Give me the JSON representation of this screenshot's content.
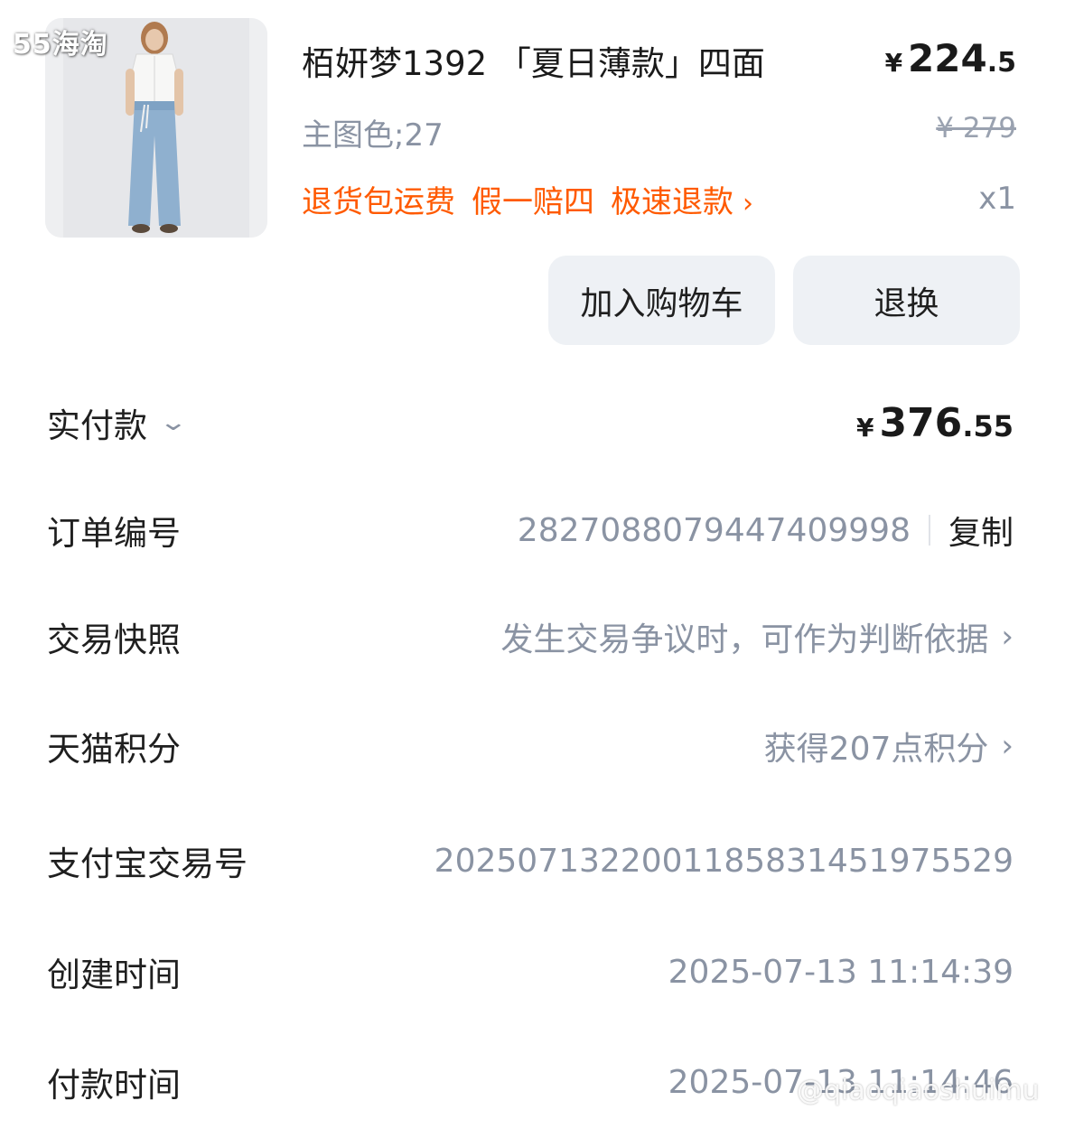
{
  "watermarks": {
    "top": "55海淘",
    "bottom": "@qiaoqiaoshuimu"
  },
  "product": {
    "image_icon": "product-photo-woman-in-jeans",
    "title": "栢妍梦1392 「夏日薄款」四面",
    "price_currency": "¥",
    "price_int": "224",
    "price_dec": ".5",
    "sku": "主图色;27",
    "original_price": "¥ 279",
    "services": [
      "退货包运费",
      "假一赔四",
      "极速退款"
    ],
    "services_chevron": "›",
    "quantity": "x1",
    "accent_color": "#ff5a00"
  },
  "actions": {
    "add_to_cart": "加入购物车",
    "return_exchange": "退换"
  },
  "details": {
    "paid": {
      "label": "实付款",
      "chevron": "⌄",
      "currency": "¥",
      "int": "376",
      "dec": ".55"
    },
    "order_no": {
      "label": "订单编号",
      "value": "2827088079447409998",
      "copy": "复制"
    },
    "snapshot": {
      "label": "交易快照",
      "value": "发生交易争议时，可作为判断依据",
      "chevron": "›"
    },
    "points": {
      "label": "天猫积分",
      "value": "获得207点积分",
      "chevron": "›"
    },
    "alipay": {
      "label": "支付宝交易号",
      "value": "2025071322001185831451975529"
    },
    "created": {
      "label": "创建时间",
      "value": "2025-07-13 11:14:39"
    },
    "paid_time": {
      "label": "付款时间",
      "value": "2025-07-13 11:14:46"
    }
  }
}
